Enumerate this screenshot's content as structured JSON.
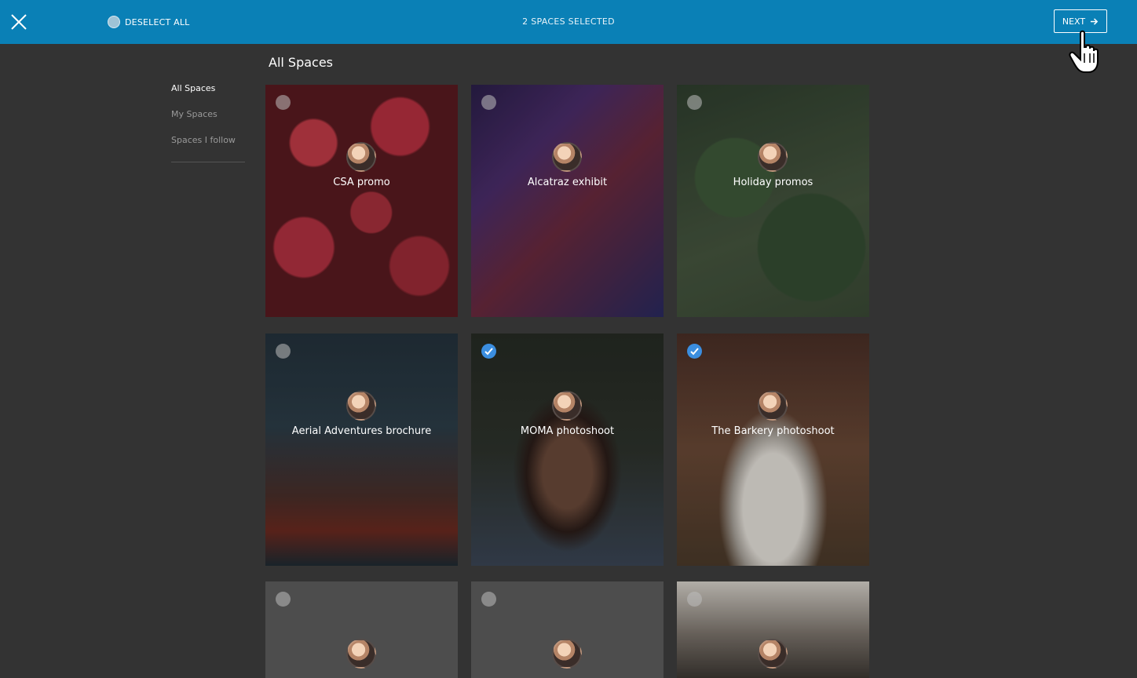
{
  "topbar": {
    "deselect_label": "DESELECT ALL",
    "selected_count": "2 SPACES SELECTED",
    "next_label": "NEXT",
    "accent_color": "#0a80b6"
  },
  "sidebar": {
    "items": [
      {
        "label": "All Spaces",
        "active": true
      },
      {
        "label": "My Spaces",
        "active": false
      },
      {
        "label": "Spaces I follow",
        "active": false
      }
    ]
  },
  "main": {
    "heading": "All Spaces",
    "cards": [
      {
        "title": "CSA promo",
        "selected": false
      },
      {
        "title": "Alcatraz exhibit",
        "selected": false
      },
      {
        "title": "Holiday promos",
        "selected": false
      },
      {
        "title": "Aerial Adventures brochure",
        "selected": true
      },
      {
        "title": "MOMA photoshoot",
        "selected": true
      },
      {
        "title": "The Barkery photoshoot",
        "selected": true
      },
      {
        "title": "",
        "selected": false
      },
      {
        "title": "",
        "selected": false
      },
      {
        "title": "",
        "selected": false
      }
    ]
  },
  "icons": {
    "close": "close-icon",
    "next_arrow": "arrow-right-icon",
    "check": "checkmark-icon",
    "cursor": "hand-pointer-icon"
  }
}
